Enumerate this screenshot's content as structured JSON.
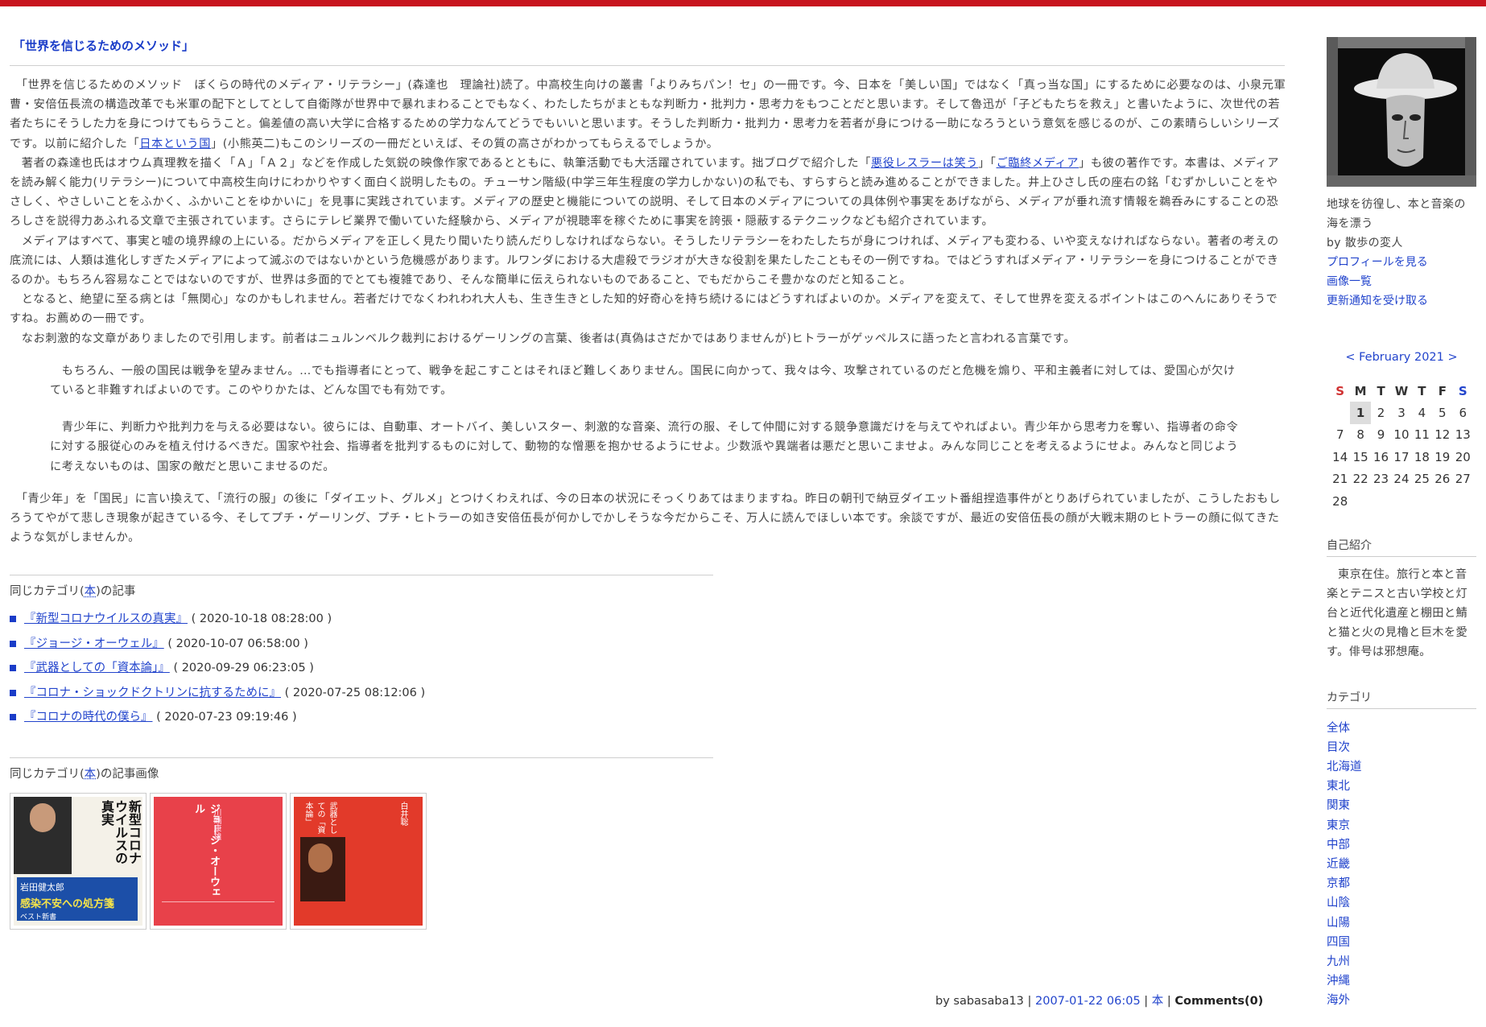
{
  "post": {
    "title": "「世界を信じるためのメソッド」",
    "p1_a": "　「世界を信じるためのメソッド　ぼくらの時代のメディア・リテラシー」(森達也　理論社)読了。中高校生向けの叢書「よりみちパン！セ」の一冊です。今、日本を「美しい国」ではなく「真っ当な国」にするために必要なのは、小泉元軍曹・安倍伍長流の構造改革でも米軍の配下としてとして自衛隊が世界中で暴れまわることでもなく、わたしたちがまともな判断力・批判力・思考力をもつことだと思います。そして魯迅が「子どもたちを救え」と書いたように、次世代の若者たちにそうした力を身につけてもらうこと。偏差値の高い大学に合格するための学力なんてどうでもいいと思います。そうした判断力・批判力・思考力を若者が身につける一助になろうという意気を感じるのが、この素晴らしいシリーズです。以前に紹介した「",
    "p1_link": "日本という国",
    "p1_b": "」(小熊英二)もこのシリーズの一冊だといえば、その質の高さがわかってもらえるでしょうか。",
    "p2_a": "　著者の森達也氏はオウム真理教を描く「Ａ」「Ａ２」などを作成した気鋭の映像作家であるとともに、執筆活動でも大活躍されています。拙ブログで紹介した「",
    "p2_link1": "悪役レスラーは笑う",
    "p2_mid": "」「",
    "p2_link2": "ご臨終メディア",
    "p2_b": "」も彼の著作です。本書は、メディアを読み解く能力(リテラシー)について中高校生向けにわかりやすく面白く説明したもの。チューサン階級(中学三年生程度の学力しかない)の私でも、すらすらと読み進めることができました。井上ひさし氏の座右の銘「むずかしいことをやさしく、やさしいことをふかく、ふかいことをゆかいに」を見事に実践されています。メディアの歴史と機能についての説明、そして日本のメディアについての具体例や事実をあげながら、メディアが垂れ流す情報を鵜呑みにすることの恐ろしさを説得力あふれる文章で主張されています。さらにテレビ業界で働いていた経験から、メディアが視聴率を稼ぐために事実を誇張・隠蔽するテクニックなども紹介されています。",
    "p3": "　メディアはすべて、事実と嘘の境界線の上にいる。だからメディアを正しく見たり聞いたり読んだりしなければならない。そうしたリテラシーをわたしたちが身につければ、メディアも変わる、いや変えなければならない。著者の考えの底流には、人類は進化しすぎたメディアによって滅ぶのではないかという危機感があります。ルワンダにおける大虐殺でラジオが大きな役割を果たしたこともその一例ですね。ではどうすればメディア・リテラシーを身につけることができるのか。もちろん容易なことではないのですが、世界は多面的でとても複雑であり、そんな簡単に伝えられないものであること、でもだからこそ豊かなのだと知ること。",
    "p4": "　となると、絶望に至る病とは「無関心」なのかもしれません。若者だけでなくわれわれ大人も、生き生きとした知的好奇心を持ち続けるにはどうすればよいのか。メディアを変えて、そして世界を変えるポイントはこのへんにありそうですね。お薦めの一冊です。",
    "p5": "　なお刺激的な文章がありましたので引用します。前者はニュルンベルク裁判におけるゲーリングの言葉、後者は(真偽はさだかではありませんが)ヒトラーがゲッペルスに語ったと言われる言葉です。",
    "quote1": "　もちろん、一般の国民は戦争を望みません。…でも指導者にとって、戦争を起こすことはそれほど難しくありません。国民に向かって、我々は今、攻撃されているのだと危機を煽り、平和主義者に対しては、愛国心が欠けていると非難すればよいのです。このやりかたは、どんな国でも有効です。",
    "quote2": "　青少年に、判断力や批判力を与える必要はない。彼らには、自動車、オートバイ、美しいスター、刺激的な音楽、流行の服、そして仲間に対する競争意識だけを与えてやればよい。青少年から思考力を奪い、指導者の命令に対する服従心のみを植え付けるべきだ。国家や社会、指導者を批判するものに対して、動物的な憎悪を抱かせるようにせよ。少数派や異端者は悪だと思いこませよ。みんな同じことを考えるようにせよ。みんなと同じように考えないものは、国家の敵だと思いこませるのだ。",
    "p6": "　「青少年」を「国民」に言い換えて、「流行の服」の後に「ダイエット、グルメ」とつけくわえれば、今の日本の状況にそっくりあてはまりますね。昨日の朝刊で納豆ダイエット番組捏造事件がとりあげられていましたが、こうしたおもしろうてやがて悲しき現象が起きている今、そしてプチ・ゲーリング、プチ・ヒトラーの如き安倍伍長が何かしでかしそうな今だからこそ、万人に読んでほしい本です。余談ですが、最近の安倍伍長の顔が大戦末期のヒトラーの顔に似てきたような気がしませんか。"
  },
  "related": {
    "head_a": "同じカテゴリ(",
    "category": "本",
    "head_b": ")の記事",
    "items": [
      {
        "title": "『新型コロナウイルスの真実』",
        "date": "( 2020-10-18 08:28:00 )"
      },
      {
        "title": "『ジョージ・オーウェル』",
        "date": "( 2020-10-07 06:58:00 )"
      },
      {
        "title": "『武器としての「資本論」』",
        "date": "( 2020-09-29 06:23:05 )"
      },
      {
        "title": "『コロナ・ショックドクトリンに抗するために』",
        "date": "( 2020-07-25 08:12:06 )"
      },
      {
        "title": "『コロナの時代の僕ら』",
        "date": "( 2020-07-23 09:19:46 )"
      }
    ]
  },
  "images": {
    "head_a": "同じカテゴリ(",
    "category": "本",
    "head_b": ")の記事画像",
    "thumb1_title": "新型コロナウイルスの真実",
    "thumb1_author": "岩田健太郎",
    "thumb1_sub": "感染不安への処方箋",
    "thumb1_series": "ベスト新書",
    "thumb2_title": "ジョージ・オーウェル",
    "thumb2_author": "川端康雄",
    "thumb3_title": "武器としての「資本論」",
    "thumb3_author": "白井聡"
  },
  "footer": {
    "by": "by sabasaba13",
    "sep": " | ",
    "datetime": "2007-01-22 06:05",
    "category": "本",
    "comments": "Comments(0)"
  },
  "sidebar": {
    "tagline": "地球を彷徨し、本と音楽の海を漂う",
    "by": "by 散歩の変人",
    "links": [
      "プロフィールを見る",
      "画像一覧",
      "更新通知を受け取る"
    ],
    "calendar": {
      "prev": "<",
      "month": "February 2021",
      "next": ">",
      "weekdays": [
        "S",
        "M",
        "T",
        "W",
        "T",
        "F",
        "S"
      ],
      "weeks": [
        [
          "",
          "1",
          "2",
          "3",
          "4",
          "5",
          "6"
        ],
        [
          "7",
          "8",
          "9",
          "10",
          "11",
          "12",
          "13"
        ],
        [
          "14",
          "15",
          "16",
          "17",
          "18",
          "19",
          "20"
        ],
        [
          "21",
          "22",
          "23",
          "24",
          "25",
          "26",
          "27"
        ],
        [
          "28",
          "",
          "",
          "",
          "",
          "",
          ""
        ]
      ],
      "today": "1"
    },
    "intro_head": "自己紹介",
    "intro": "東京在住。旅行と本と音楽とテニスと古い学校と灯台と近代化遺産と棚田と鯖と猫と火の見櫓と巨木を愛す。俳号は邪想庵。",
    "cat_head": "カテゴリ",
    "categories": [
      "全体",
      "目次",
      "北海道",
      "東北",
      "関東",
      "東京",
      "中部",
      "近畿",
      "京都",
      "山陰",
      "山陽",
      "四国",
      "九州",
      "沖縄",
      "海外"
    ]
  },
  "colors": {
    "topbar": "#c8141e",
    "link": "#2244cc",
    "title": "#1a3cc8"
  }
}
